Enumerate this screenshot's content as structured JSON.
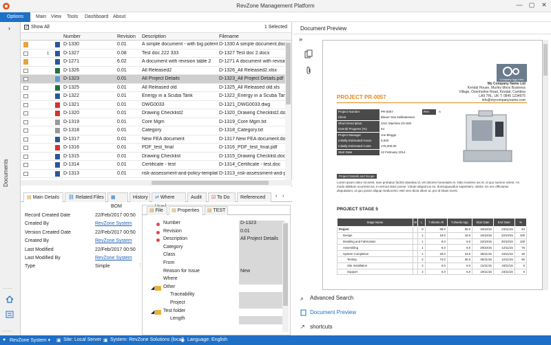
{
  "window": {
    "title": "RevZone Management Platform",
    "minimize": "—",
    "maximize": "▢",
    "close": "✕"
  },
  "menu": {
    "options": "Options",
    "items": [
      "Main",
      "View",
      "Tools",
      "Dashboard",
      "About"
    ]
  },
  "left_panel": {
    "label": "Documents"
  },
  "grid": {
    "show_all": "Show All",
    "selection": "1 Selected",
    "columns": [
      "Number",
      "Revision",
      "Description",
      "Filename"
    ],
    "rows": [
      {
        "icons": [
          "pencil",
          "",
          "word"
        ],
        "number": "D-1330",
        "revision": "0.01",
        "description": "A simple document - with big potential",
        "filename": "D-1330 A simple document.docx"
      },
      {
        "icons": [
          "",
          "clip",
          "word"
        ],
        "number": "D-1327",
        "revision": "0.08",
        "description": "Test doc 222 333",
        "filename": "D-1327 Test doc 2.docx"
      },
      {
        "icons": [
          "pencil",
          "",
          "word"
        ],
        "number": "D-1271",
        "revision": "6.02",
        "description": "A document with revision table 2",
        "filename": "D-1271 A document with revision"
      },
      {
        "icons": [
          "",
          "",
          "excel"
        ],
        "number": "D-1326",
        "revision": "0.01",
        "description": "All Released2",
        "filename": "D-1326_All Released2.xlsx"
      },
      {
        "icons": [
          "",
          "",
          "img"
        ],
        "number": "D-1323",
        "revision": "0.01",
        "description": "All Project Details",
        "filename": "D-1323_All Project Details.pdf",
        "selected": true
      },
      {
        "icons": [
          "",
          "",
          "excel"
        ],
        "number": "D-1325",
        "revision": "0.01",
        "description": "All Released old",
        "filename": "D-1325_All Released old.xls"
      },
      {
        "icons": [
          "",
          "",
          "word"
        ],
        "number": "D-1322",
        "revision": "0.01",
        "description": "Energy in a Scuba Tank",
        "filename": "D-1322_Energy in a Scuba Tank"
      },
      {
        "icons": [
          "",
          "",
          "pdf"
        ],
        "number": "D-1321",
        "revision": "0.01",
        "description": "DWG0033",
        "filename": "D-1321_DWG0033.dwg"
      },
      {
        "icons": [
          "",
          "",
          "pdf"
        ],
        "number": "D-1320",
        "revision": "0.01",
        "description": "Drawing Checklist2",
        "filename": "D-1320_Drawing Checklist2.docx"
      },
      {
        "icons": [
          "",
          "",
          "txt"
        ],
        "number": "D-1319",
        "revision": "0.01",
        "description": "Core Mgm",
        "filename": "D-1319_Core Mgm.txt"
      },
      {
        "icons": [
          "",
          "",
          "txt"
        ],
        "number": "D-1318",
        "revision": "0.01",
        "description": "Category",
        "filename": "D-1318_Category.txt"
      },
      {
        "icons": [
          "",
          "",
          "word"
        ],
        "number": "D-1317",
        "revision": "0.01",
        "description": "New FEA document",
        "filename": "D-1317 New FEA document.docx"
      },
      {
        "icons": [
          "",
          "",
          "pdf"
        ],
        "number": "D-1316",
        "revision": "0.01",
        "description": "PDF_test_final",
        "filename": "D-1316_PDF_test_final.pdf"
      },
      {
        "icons": [
          "",
          "",
          "word"
        ],
        "number": "D-1315",
        "revision": "0.01",
        "description": "Drawing Checklist",
        "filename": "D-1315_Drawing Checklist.doc"
      },
      {
        "icons": [
          "",
          "",
          "word"
        ],
        "number": "D-1314",
        "revision": "0.01",
        "description": "Certificate - test",
        "filename": "D-1314_Certificate - test.doc"
      },
      {
        "icons": [
          "",
          "",
          "word"
        ],
        "number": "D-1313",
        "revision": "0.01",
        "description": "risk-assessment-and-policy-template",
        "filename": "D-1313_risk-assessment-and-poli"
      }
    ]
  },
  "bottom_tabs": [
    "Main Details",
    "Related Files",
    "BOM",
    "History",
    "Where Used",
    "Audit",
    "To Do",
    "Referenced"
  ],
  "details": [
    {
      "label": "Record Created Date",
      "value": "22/Feb/2017 00:50",
      "link": false
    },
    {
      "label": "Created By",
      "value": "RevZone System",
      "link": true
    },
    {
      "label": "Version Created Date",
      "value": "22/Feb/2017 00:50",
      "link": false
    },
    {
      "label": "Created By",
      "value": "RevZone System",
      "link": true
    },
    {
      "label": "Last Modified",
      "value": "22/Feb/2017 00:50",
      "link": false
    },
    {
      "label": "Last Modified By",
      "value": "RevZone System",
      "link": true
    },
    {
      "label": "Type",
      "value": "Simple",
      "link": false
    }
  ],
  "properties": {
    "tabs": [
      "File",
      "Properties",
      "TEST"
    ],
    "rows": [
      {
        "label": "Number",
        "value": "D-1323",
        "required": true
      },
      {
        "label": "Revision",
        "value": "0.01",
        "required": true
      },
      {
        "label": "Description",
        "value": "All Project Details",
        "required": true
      },
      {
        "label": "Category",
        "value": ""
      },
      {
        "label": "Class",
        "value": ""
      },
      {
        "label": "From",
        "value": ""
      },
      {
        "label": "Reason for Issue",
        "value": "New"
      },
      {
        "label": "Where",
        "value": ""
      },
      {
        "label": "Other",
        "value": "",
        "folder": true
      },
      {
        "label": "Traceability",
        "value": "",
        "indent": true
      },
      {
        "label": "Project",
        "value": "",
        "indent": true
      },
      {
        "label": "Test folder",
        "value": "",
        "folder": true
      },
      {
        "label": "Length",
        "value": "",
        "indent": true
      }
    ]
  },
  "preview": {
    "title": "Document Preview",
    "links": [
      "Advanced Search",
      "Document Preview",
      "shortcuts"
    ],
    "doc": {
      "logo_text": "Company logo here",
      "company": [
        "My Company Name Ltd",
        "Kendal House, Murley Moss Business",
        "Village, Oxenholme Road, Kendal, Cumbria",
        "LA9 7RL, UK T: 0845 1234675",
        "info@mycompanyname.com"
      ],
      "project_title": "PROJECT PR-0057",
      "info": [
        {
          "k": "Project Number",
          "v": "PR-0057",
          "k2": "Rev.",
          "v2": "A"
        },
        {
          "k": "Client",
          "v": "Blauer See Delikatessen"
        },
        {
          "k": "Short Description",
          "v": "CNC Machine ZX-500"
        },
        {
          "k": "Overall Progress (%)",
          "v": "64"
        },
        {
          "k": "Project Manager",
          "v": "Joe Bloggs"
        },
        {
          "k": "Initially Estimated Hours",
          "v": "5,000"
        },
        {
          "k": "Initially Estimated Costs",
          "v": "176,000.00"
        },
        {
          "k": "Start Date",
          "v": "12 February 2014"
        }
      ],
      "scope_label": "Project Details and Scope",
      "lorem": "Lorem ipsum dolor sit amet, eam probatus facilisi ubanitas id, vel dolores honestatis et. Odio insolens ius et, id quo summo sclent. An modo dabitum ocurreret ius, in eirmod dolor posse. Virtute aliquid ius eu, dominguavidus sapientem, ridolor. Ex nec efficiantur disputationi, ut quo posse aliquip mediocrem. Mel vero dicta ullum ut, pro id tritani everti.",
      "stage_title": "PROJECT STAGE 5",
      "table_headers": [
        "Stage Name",
        "W",
        "L",
        "T.sheets All",
        "T.sheets App",
        "Start Date",
        "End Date",
        "%"
      ],
      "table_rows": [
        {
          "name": "Project",
          "bold": true,
          "w": "",
          "l": "0",
          "a": "58.0",
          "b": "56.0",
          "s": "16/10/15",
          "e": "23/11/15",
          "p": "64"
        },
        {
          "name": "Design",
          "lvl": 1,
          "w": "",
          "l": "1",
          "a": "18.0",
          "b": "18.0",
          "s": "16/10/15",
          "e": "23/10/15",
          "p": "100"
        },
        {
          "name": "Detailing and Fabrication",
          "lvl": 1,
          "w": "",
          "l": "1",
          "a": "9.0",
          "b": "9.0",
          "s": "22/10/15",
          "e": "30/10/15",
          "p": "100"
        },
        {
          "name": "Assembling",
          "lvl": 1,
          "w": "",
          "l": "1",
          "a": "6.0",
          "b": "6.0",
          "s": "29/10/15",
          "e": "12/11/15",
          "p": "75"
        },
        {
          "name": "System Completion",
          "lvl": 1,
          "w": "",
          "l": "1",
          "a": "25.0",
          "b": "23.0",
          "s": "05/11/15",
          "e": "23/11/15",
          "p": "20"
        },
        {
          "name": "Testing",
          "lvl": 2,
          "w": "",
          "l": "2",
          "a": "74.0",
          "b": "36.0",
          "s": "05/11/15",
          "e": "12/11/15",
          "p": "50"
        },
        {
          "name": "Site Installation",
          "lvl": 2,
          "w": "",
          "l": "2",
          "a": "6.0",
          "b": "6.0",
          "s": "12/11/15",
          "e": "19/11/15",
          "p": "0"
        },
        {
          "name": "Support",
          "lvl": 2,
          "w": "",
          "l": "2",
          "a": "5.0",
          "b": "5.0",
          "s": "19/11/15",
          "e": "23/11/15",
          "p": "0"
        }
      ]
    }
  },
  "status": {
    "user": "RevZone System ▾",
    "site": "Site: Local Server",
    "system": "System: RevZone Solutions (local)",
    "language": "Language: English"
  },
  "colors": {
    "accent": "#1e6fc6",
    "orange": "#e48a17",
    "selected_row": "#cfcfcf"
  }
}
